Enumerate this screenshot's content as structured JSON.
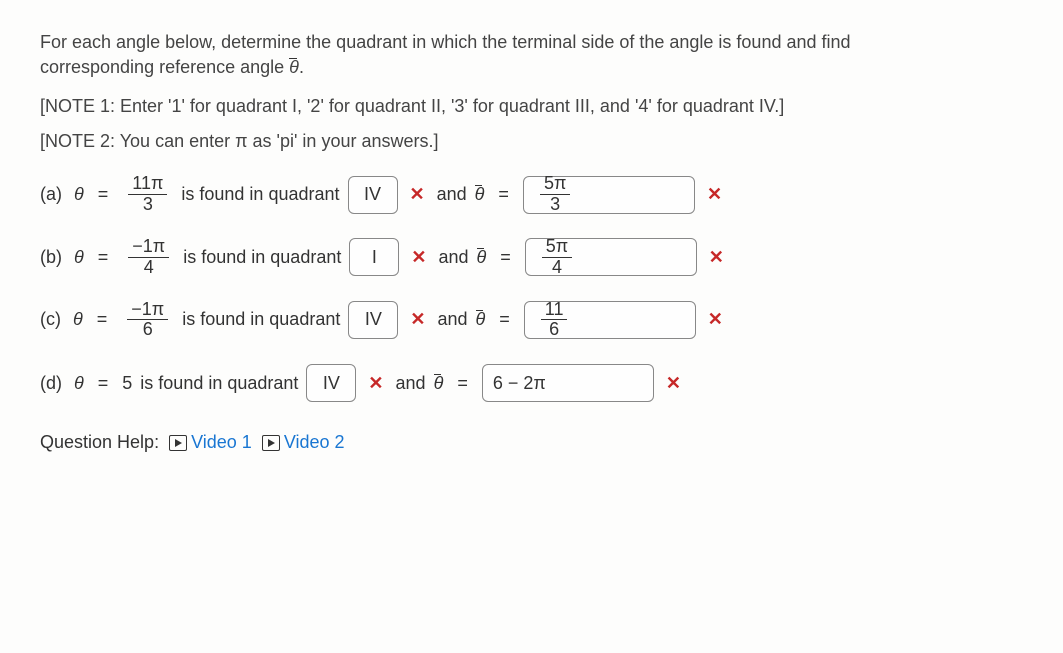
{
  "intro_line1": "For each angle below, determine the quadrant in which the terminal side of the angle is found and find",
  "intro_line2_prefix": "corresponding reference angle ",
  "intro_line2_suffix": ".",
  "note1": "[NOTE 1: Enter '1' for quadrant I, '2' for quadrant II, '3' for quadrant III, and '4' for quadrant IV.]",
  "note2": "[NOTE 2: You can enter π as 'pi' in your answers.]",
  "parts": {
    "a": {
      "label": "(a)",
      "theta_num": "11π",
      "theta_den": "3",
      "mid_text": " is found in quadrant ",
      "quadrant_value": "IV",
      "and_text": " and ",
      "ref_num": "5π",
      "ref_den": "3"
    },
    "b": {
      "label": "(b)",
      "theta_num": "−1π",
      "theta_den": "4",
      "mid_text": " is found in quadrant ",
      "quadrant_value": "I",
      "and_text": " and ",
      "ref_num": "5π",
      "ref_den": "4"
    },
    "c": {
      "label": "(c)",
      "theta_num": "−1π",
      "theta_den": "6",
      "mid_text": " is found in quadrant ",
      "quadrant_value": "IV",
      "and_text": " and ",
      "ref_num": "11",
      "ref_den": "6"
    },
    "d": {
      "label": "(d)",
      "theta_text": "5",
      "mid_text": " is found in quadrant ",
      "quadrant_value": "IV",
      "and_text": " and ",
      "ref_value": "6 − 2π"
    }
  },
  "symbols": {
    "theta": "θ",
    "thetabar": "θ",
    "equals": "=",
    "cross": "✕"
  },
  "help": {
    "label": "Question Help:",
    "video1": "Video 1",
    "video2": "Video 2"
  }
}
